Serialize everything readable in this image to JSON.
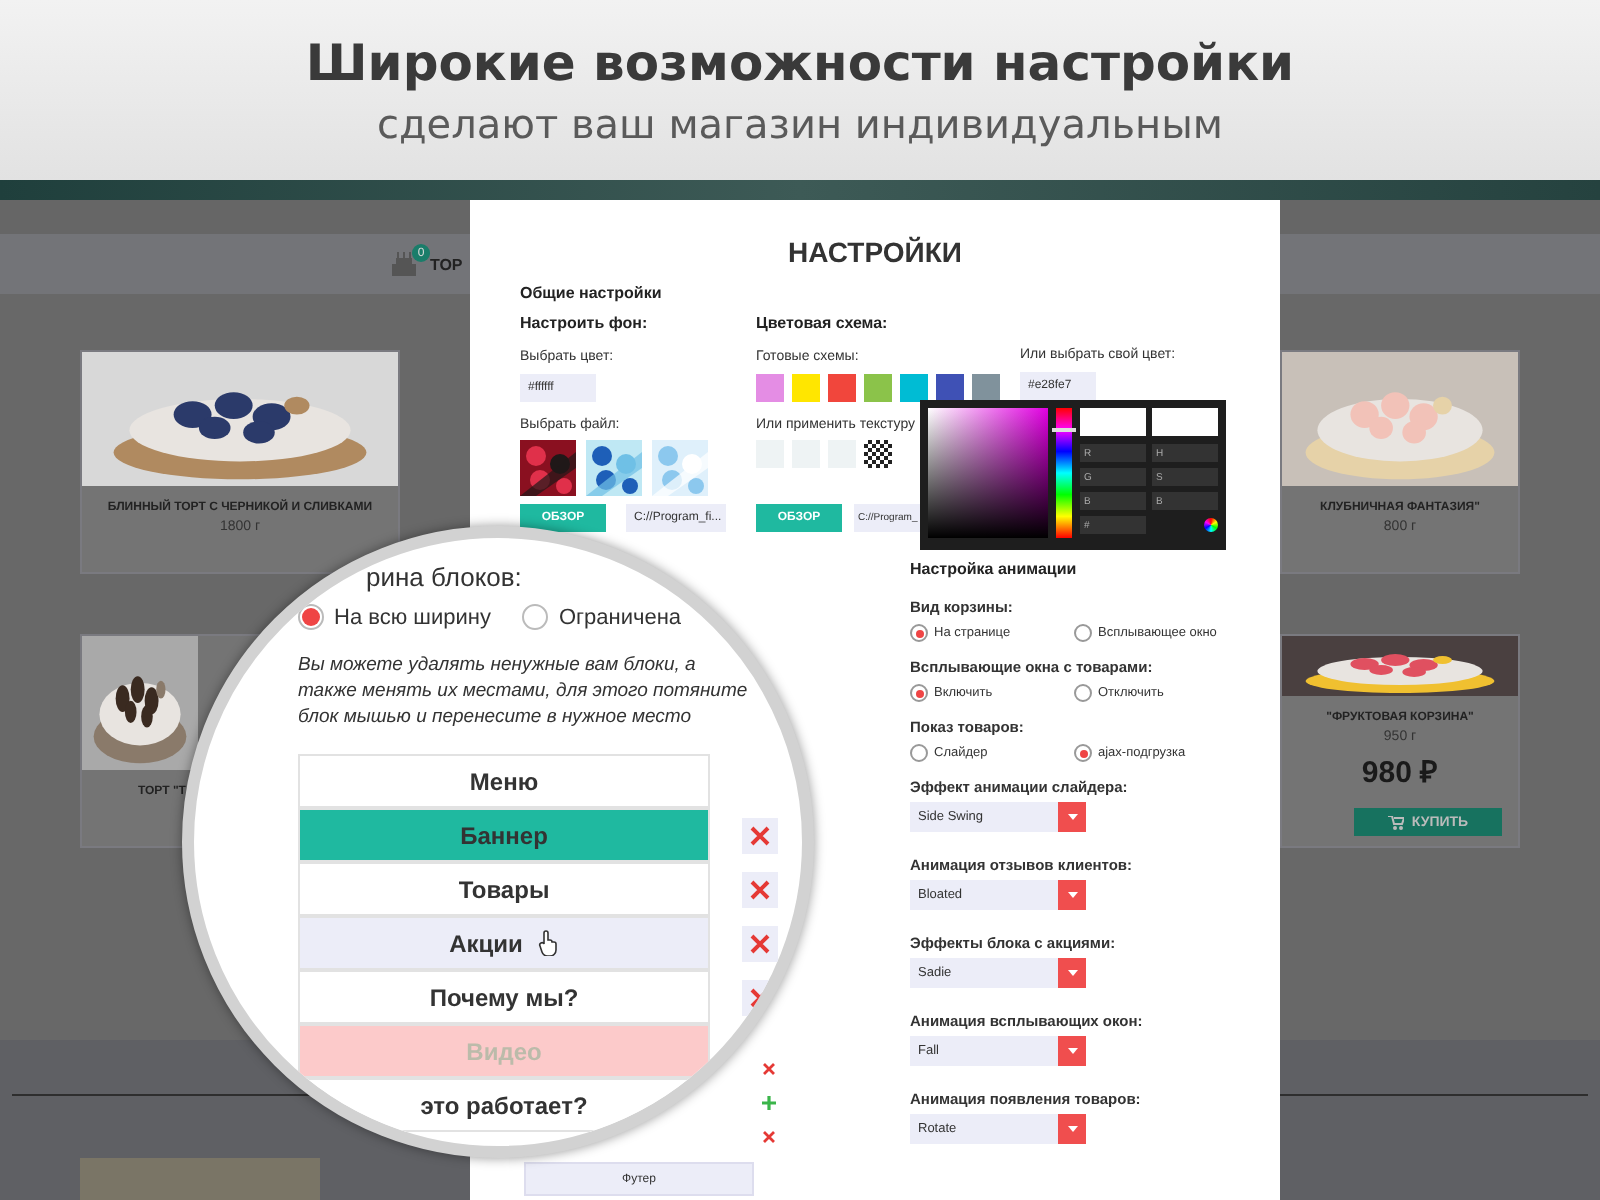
{
  "header": {
    "title": "Широкие возможности настройки",
    "subtitle": "сделают ваш магазин индивидуальным"
  },
  "shop": {
    "cart_badge": "0",
    "nav_item": "ТОР",
    "products": [
      {
        "name": "БЛИННЫЙ ТОРТ С ЧЕРНИКОЙ И СЛИВКАМИ",
        "weight": "1800 г"
      },
      {
        "name": "КЛУБНИЧНАЯ ФАНТАЗИЯ\"",
        "weight": "800 г"
      },
      {
        "name": "ТОРТ \"Т"
      },
      {
        "name": "\"ФРУКТОВАЯ КОРЗИНА\"",
        "weight": "950 г",
        "price": "980 ₽",
        "buy": "КУПИТЬ"
      }
    ]
  },
  "settings": {
    "title": "НАСТРОЙКИ",
    "section": "Общие настройки",
    "background": {
      "heading": "Настроить фон:",
      "color_label": "Выбрать цвет:",
      "color_value": "#ffffff",
      "file_label": "Выбрать файл:",
      "browse": "ОБЗОР",
      "path": "C://Program_fi..."
    },
    "scheme": {
      "heading": "Цветовая схема:",
      "presets_label": "Готовые схемы:",
      "presets": [
        {
          "color": "#e48de4"
        },
        {
          "color": "#ffe600"
        },
        {
          "color": "#f1463c"
        },
        {
          "color": "#8bc34a"
        },
        {
          "color": "#00bcd4"
        },
        {
          "color": "#3f51b5"
        },
        {
          "color": "#80929c"
        }
      ],
      "texture_label": "Или применить текстуру",
      "textures": [
        {
          "kind": "light"
        },
        {
          "kind": "light"
        },
        {
          "kind": "light"
        },
        {
          "kind": "checker"
        }
      ],
      "browse": "ОБЗОР",
      "path": "C://Program_",
      "custom_label": "Или выбрать свой цвет:",
      "custom_value": "#e28fe7"
    },
    "picker": {
      "hue_slider": {
        "level": 0.82
      },
      "fields": [
        "R",
        "H",
        "G",
        "S",
        "B",
        "B"
      ],
      "hex_label": "#"
    },
    "animation": {
      "heading": "Настройка анимации",
      "radio_groups": [
        {
          "label": "Вид корзины:",
          "options": [
            {
              "label": "На странице",
              "selected": true
            },
            {
              "label": "Всплывающее окно",
              "selected": false
            }
          ]
        },
        {
          "label": "Всплывающие окна с товарами:",
          "options": [
            {
              "label": "Включить",
              "selected": true
            },
            {
              "label": "Отключить",
              "selected": false
            }
          ]
        },
        {
          "label": "Показ товаров:",
          "options": [
            {
              "label": "Слайдер",
              "selected": false
            },
            {
              "label": "ajax-подгрузка",
              "selected": true
            }
          ]
        }
      ],
      "selects": [
        {
          "label": "Эффект анимации слайдера:",
          "value": "Side Swing"
        },
        {
          "label": "Анимация отзывов клиентов:",
          "value": "Bloated"
        },
        {
          "label": "Эффекты блока с акциями:",
          "value": "Sadie"
        },
        {
          "label": "Анимация всплывающих окон:",
          "value": "Fall"
        },
        {
          "label": "Анимация появления товаров:",
          "value": "Rotate"
        }
      ]
    },
    "side_actions": [
      {
        "kind": "remove"
      },
      {
        "kind": "add"
      },
      {
        "kind": "remove"
      }
    ],
    "footer_block": "Футер"
  },
  "magnifier": {
    "heading": "рина блоков:",
    "width_options": [
      {
        "label": "На всю ширину",
        "selected": true
      },
      {
        "label": "Ограничена",
        "selected": false
      }
    ],
    "hint": "Вы можете удалять ненужные вам блоки, а также менять их местами, для этого потяните блок мышью и перенесите в нужное место",
    "blocks": [
      {
        "label": "Меню",
        "kind": "plain",
        "removable": false
      },
      {
        "label": "Баннер",
        "kind": "active",
        "removable": true
      },
      {
        "label": "Товары",
        "kind": "plain",
        "removable": true
      },
      {
        "label": "Акции",
        "kind": "hover",
        "removable": true
      },
      {
        "label": "Почему мы?",
        "kind": "plain",
        "removable": true
      },
      {
        "label": "Видео",
        "kind": "disabled",
        "removable": false
      },
      {
        "label": "это работает?",
        "kind": "plain",
        "removable": false
      }
    ]
  }
}
